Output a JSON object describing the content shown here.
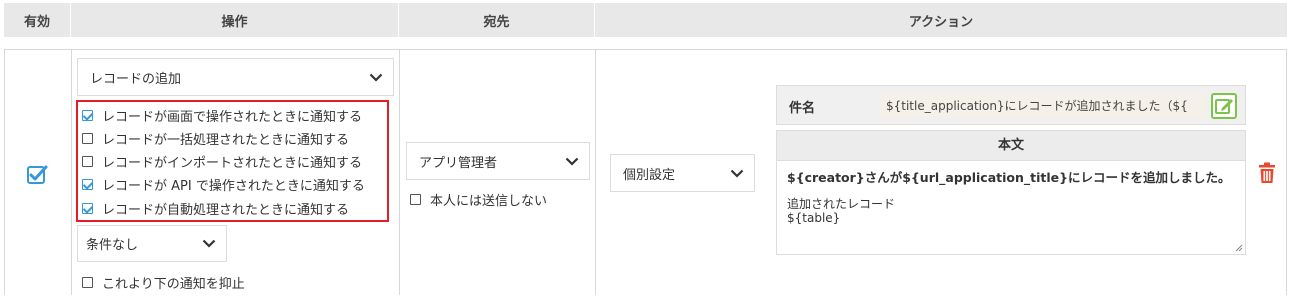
{
  "header": {
    "valid": "有効",
    "operation": "操作",
    "destination": "宛先",
    "action": "アクション"
  },
  "row": {
    "enabled": true,
    "operation_select": "レコードの追加",
    "notify_options": [
      {
        "label": "レコードが画面で操作されたときに通知する",
        "checked": true
      },
      {
        "label": "レコードが一括処理されたときに通知する",
        "checked": false
      },
      {
        "label": "レコードがインポートされたときに通知する",
        "checked": false
      },
      {
        "label": "レコードが API で操作されたときに通知する",
        "checked": true
      },
      {
        "label": "レコードが自動処理されたときに通知する",
        "checked": true
      }
    ],
    "condition_select": "条件なし",
    "suppress_label": "これより下の通知を抑止",
    "destination_select": "アプリ管理者",
    "self_exclude_label": "本人には送信しない",
    "action_select": "個別設定",
    "subject_label": "件名",
    "subject_value": "${title_application}にレコードが追加されました（${",
    "body_label": "本文",
    "body_line1": "${creator}さんが${url_application_title}にレコードを追加しました。",
    "body_line2": "追加されたレコード",
    "body_line3": "${table}"
  },
  "colors": {
    "check_blue": "#3498db",
    "highlight_red": "#e21e26",
    "edit_green": "#7cc34a",
    "trash_red": "#e8482e"
  },
  "icons": [
    "checkbox-checked-icon",
    "chevron-down-icon",
    "edit-icon",
    "trash-icon"
  ]
}
